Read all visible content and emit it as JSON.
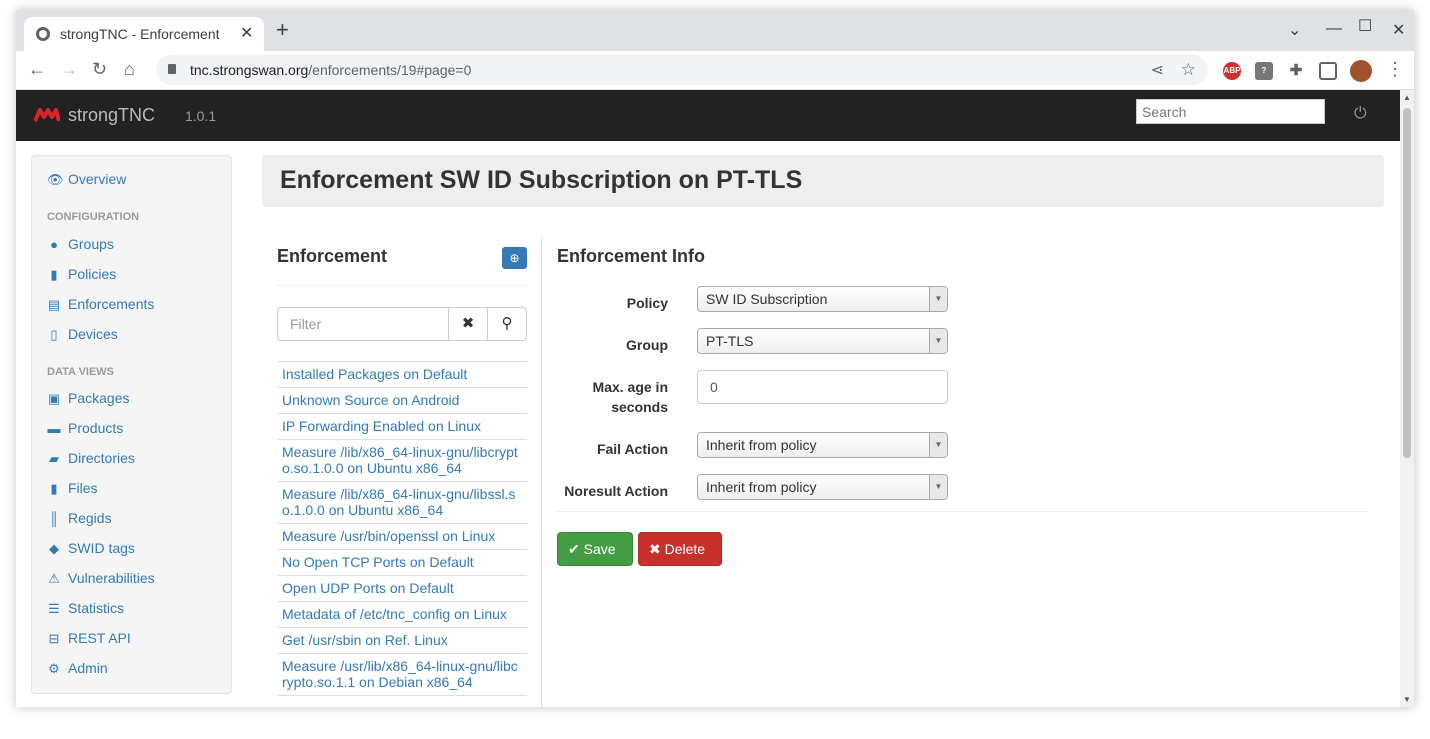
{
  "browser": {
    "tab_title": "strongTNC - Enforcement",
    "url_domain": "tnc.strongswan.org",
    "url_path": "/enforcements/19#page=0",
    "extension_abp": "ABP"
  },
  "navbar": {
    "brand": "strongTNC",
    "version": "1.0.1",
    "search_placeholder": "Search"
  },
  "sidebar": {
    "overview": "Overview",
    "config_header": "CONFIGURATION",
    "config_items": [
      "Groups",
      "Policies",
      "Enforcements",
      "Devices"
    ],
    "dataviews_header": "DATA VIEWS",
    "dataview_items": [
      "Packages",
      "Products",
      "Directories",
      "Files",
      "Regids",
      "SWID tags",
      "Vulnerabilities",
      "Statistics",
      "REST API",
      "Admin"
    ]
  },
  "page": {
    "title": "Enforcement SW ID Subscription on PT-TLS"
  },
  "enforcement_list": {
    "heading": "Enforcement",
    "filter_placeholder": "Filter",
    "items": [
      "Installed Packages on Default",
      "Unknown Source on Android",
      "IP Forwarding Enabled on Linux",
      "Measure  /lib/x86_64-linux-gnu/libcrypto.so.1.0.0 on Ubuntu x86_64",
      "Measure  /lib/x86_64-linux-gnu/libssl.so.1.0.0 on Ubuntu x86_64",
      "Measure /usr/bin/openssl on Linux",
      "No Open TCP Ports on Default",
      "Open UDP Ports on Default",
      "Metadata of /etc/tnc_config on Linux",
      "Get /usr/sbin on Ref. Linux",
      "Measure  /usr/lib/x86_64-linux-gnu/libcrypto.so.1.1 on Debian x86_64"
    ]
  },
  "enforcement_info": {
    "heading": "Enforcement Info",
    "policy_label": "Policy",
    "policy_value": "SW ID Subscription",
    "group_label": "Group",
    "group_value": "PT-TLS",
    "maxage_label_1": "Max. age in",
    "maxage_label_2": "seconds",
    "maxage_value": "0",
    "fail_label": "Fail Action",
    "fail_value": "Inherit from policy",
    "noresult_label": "Noresult Action",
    "noresult_value": "Inherit from policy",
    "save_label": "Save",
    "delete_label": "Delete"
  }
}
